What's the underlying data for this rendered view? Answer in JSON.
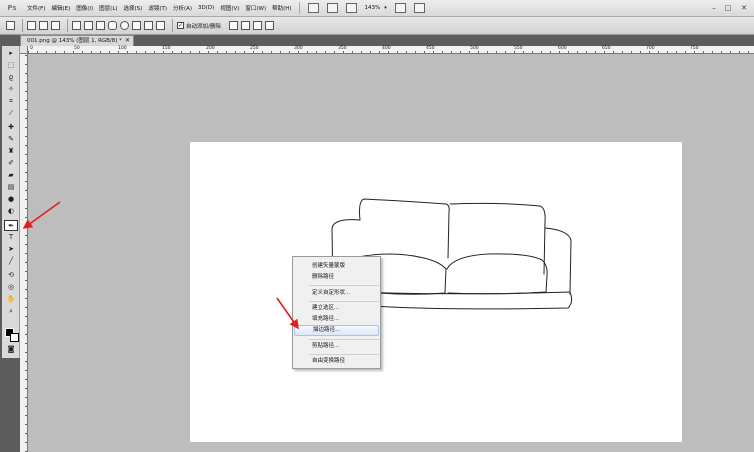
{
  "app": {
    "logo": "Ps",
    "menu": [
      "文件(F)",
      "编辑(E)",
      "图像(I)",
      "图层(L)",
      "选择(S)",
      "滤镜(T)",
      "分析(A)",
      "3D(D)",
      "视图(V)",
      "窗口(W)",
      "帮助(H)"
    ],
    "zoom": "143%",
    "window_controls": [
      "–",
      "□",
      "✕"
    ]
  },
  "options_bar": {
    "auto_add_delete_label": "自动添加/删除",
    "auto_add_delete_checked": true
  },
  "document": {
    "tab_title": "001.png @ 143% (图层 1, RGB/8) *",
    "close": "✕"
  },
  "ruler": {
    "top_labels": [
      "0",
      "50",
      "100",
      "150",
      "200",
      "250",
      "300",
      "350",
      "400",
      "450",
      "500",
      "550",
      "600",
      "650",
      "700",
      "750"
    ]
  },
  "context_menu": {
    "items": [
      "创建矢量蒙版",
      "删除路径",
      "定义自定形状...",
      "建立选区...",
      "填充路径...",
      "描边路径...",
      "剪贴路径...",
      "自由变换路径"
    ],
    "highlighted_index": 5
  },
  "colors": {
    "accent_arrow": "#e02020",
    "menu_highlight": "#dbe8f6",
    "workspace": "#bdbdbd"
  }
}
